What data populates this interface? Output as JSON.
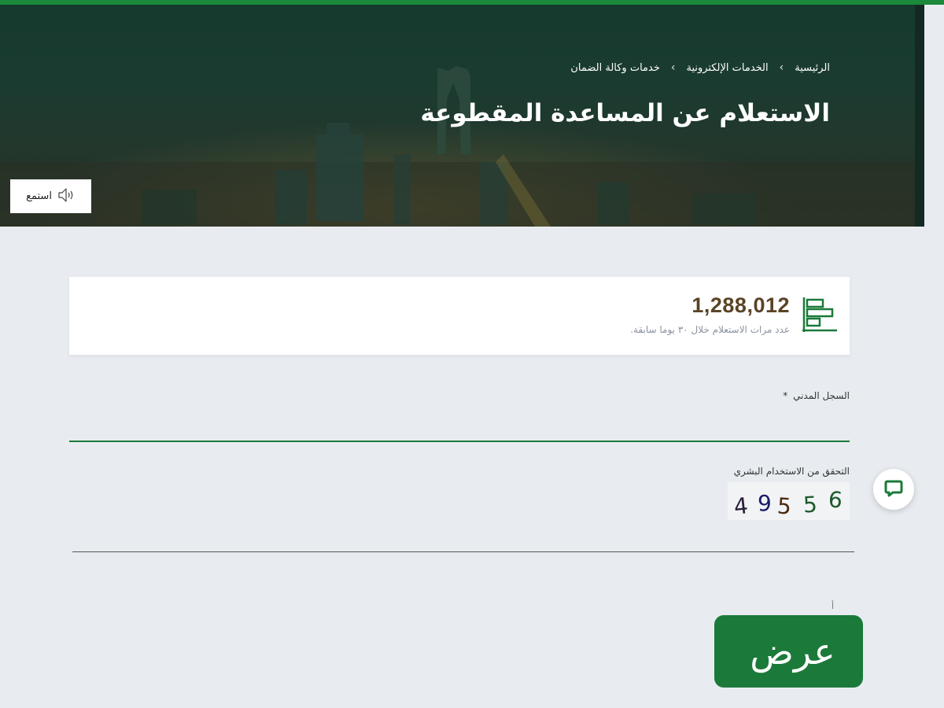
{
  "header": {
    "breadcrumb": {
      "home": "الرئيسية",
      "eservices": "الخدمات الإلكترونية",
      "current": "خدمات وكالة الضمان",
      "separator": "›"
    },
    "title": "الاستعلام عن المساعدة المقطوعة",
    "listen_label": "استمع"
  },
  "stats": {
    "count": "1,288,012",
    "caption": "عدد مرات الاستعلام خلال ٣٠ يوما سابقة."
  },
  "form": {
    "civil_label": "السجل المدني",
    "required_mark": "*",
    "civil_value": "",
    "captcha_label": "التحقق من الاستخدام البشري",
    "captcha_digits": [
      "4",
      "9",
      "5",
      "5",
      "6"
    ],
    "captcha_value": "",
    "tiny_mark": "أ",
    "submit_label": "عرض"
  },
  "icons": {
    "listen": "speaker-icon",
    "stats": "bar-chart-icon",
    "chat": "chat-icon"
  },
  "colors": {
    "brand_green": "#1b7a3a",
    "top_strip": "#1b8a3a",
    "stat_number": "#5a4426",
    "page_bg": "#e8ecf0"
  }
}
